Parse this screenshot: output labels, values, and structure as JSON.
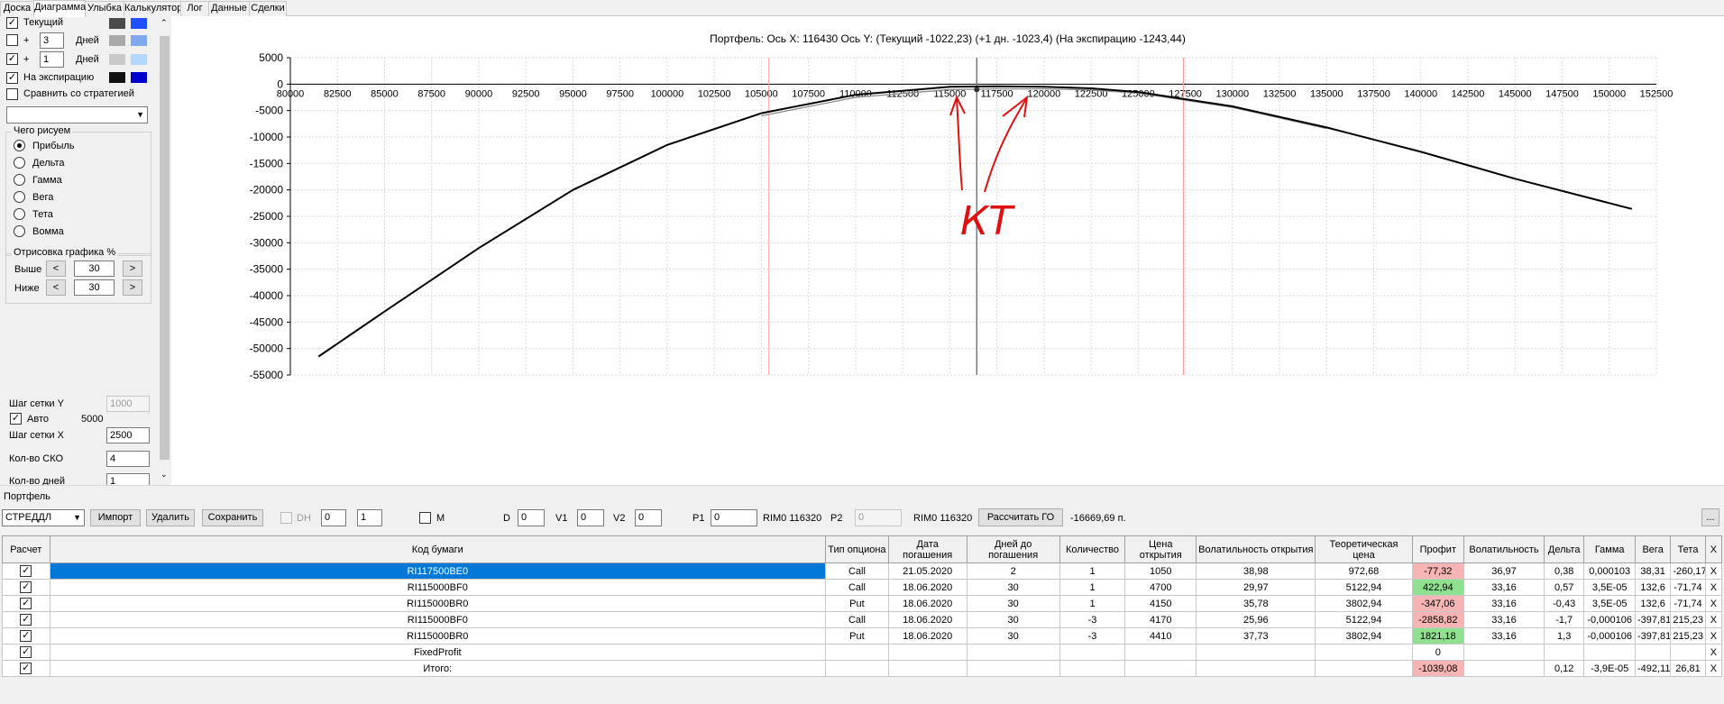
{
  "tabs": [
    "Доска",
    "Диаграмма",
    "Улыбка",
    "Калькулятор",
    "Лог",
    "Данные",
    "Сделки"
  ],
  "left": {
    "row1_label": "Текущий",
    "row2_value": "3",
    "row2_unit": "Дней",
    "row3_value": "1",
    "row3_unit": "Дней",
    "row4_label": "На экспирацию",
    "compare_label": "Сравнить со стратегией",
    "plus": "+",
    "group_draw_title": "Чего рисуем",
    "radios": [
      "Прибыль",
      "Дельта",
      "Гамма",
      "Вега",
      "Тета",
      "Вомма"
    ],
    "group_range_title": "Отрисовка графика %",
    "above_label": "Выше",
    "above_value": "30",
    "below_label": "Ниже",
    "below_value": "30",
    "btn_less": "<",
    "btn_more": ">",
    "grid_y_label": "Шаг сетки Y",
    "grid_y_value": "1000",
    "auto_label": "Авто",
    "auto_value": "5000",
    "grid_x_label": "Шаг сетки X",
    "grid_x_value": "2500",
    "sko_label": "Кол-во СКО",
    "sko_value": "4",
    "days_label": "Кол-во дней",
    "days_value": "1",
    "swatch_colors": [
      "#4a4a4a",
      "#1f4fff",
      "#a8a8a8",
      "#7fa8ee",
      "#c9c9c9",
      "#b3d8fb",
      "#111111",
      "#0000cc"
    ]
  },
  "chart_header": "Портфель: Ось X: 116430 Ось Y:  (Текущий -1022,23)  (+1 дн. -1023,4)  (На экспирацию -1243,44)",
  "annotation_text": "КТ",
  "chart_data": {
    "type": "line",
    "x_ticks": [
      "80000",
      "82500",
      "85000",
      "87500",
      "90000",
      "92500",
      "95000",
      "97500",
      "100000",
      "102500",
      "105000",
      "107500",
      "110000",
      "112500",
      "115000",
      "117500",
      "120000",
      "122500",
      "125000",
      "127500",
      "130000",
      "132500",
      "135000",
      "137500",
      "140000",
      "142500",
      "145000",
      "147500",
      "150000",
      "152500"
    ],
    "y_ticks": [
      "5000",
      "0",
      "-5000",
      "-10000",
      "-15000",
      "-20000",
      "-25000",
      "-30000",
      "-35000",
      "-40000",
      "-45000",
      "-50000",
      "-55000"
    ],
    "xlim": [
      80000,
      152500
    ],
    "ylim": [
      -55000,
      5000
    ],
    "cursor_x": 116430,
    "sd_lines_x": [
      105400,
      127400
    ],
    "series": [
      {
        "color": "#000000",
        "x": [
          81500,
          85000,
          90000,
          95000,
          100000,
          105000,
          110000,
          115000,
          117500,
          120000,
          122500,
          125000,
          130000,
          135000,
          140000,
          145000,
          150000,
          151200
        ],
        "y": [
          -51500,
          -43000,
          -31000,
          -20000,
          -11500,
          -5500,
          -2000,
          -500,
          -400,
          -500,
          -800,
          -1500,
          -4200,
          -8200,
          -12800,
          -17900,
          -22500,
          -23600
        ]
      },
      {
        "color": "#8c8c8c",
        "x": [
          105000,
          110000,
          115000,
          117500,
          120000,
          122500,
          125000,
          130000,
          135000
        ],
        "y": [
          -6000,
          -2500,
          -1022,
          -900,
          -900,
          -1100,
          -1700,
          -4400,
          -8400
        ]
      }
    ]
  },
  "portfolio": {
    "title": "Портфель",
    "strategy": "СТРЕДДЛ",
    "btn_import": "Импорт",
    "btn_delete": "Удалить",
    "btn_save": "Сохранить",
    "dh_label": "DH",
    "dh_val1": "0",
    "dh_val2": "1",
    "m_label": "M",
    "d_label": "D",
    "d_value": "0",
    "v1_label": "V1",
    "v1_value": "0",
    "v2_label": "V2",
    "v2_value": "0",
    "p1_label": "P1",
    "p1_value": "0",
    "rim1": "RIM0 116320",
    "p2_label": "P2",
    "p2_value": "0",
    "rim2": "RIM0 116320",
    "btn_calc": "Рассчитать ГО",
    "go_value": "-16669,69 п.",
    "btn_more": "...",
    "headers": [
      "Расчет",
      "Код бумаги",
      "Тип опциона",
      "Дата погашения",
      "Дней до погашения",
      "Количество",
      "Цена открытия",
      "Волатильность открытия",
      "Теоретическая цена",
      "Профит",
      "Волатильность",
      "Дельта",
      "Гамма",
      "Вега",
      "Тета",
      "X"
    ],
    "rows": [
      [
        "RI117500BE0",
        "Call",
        "21.05.2020",
        "2",
        "1",
        "1050",
        "38,98",
        "972,68",
        "-77,32",
        "36,97",
        "0,38",
        "0,000103",
        "38,31",
        "-260,17",
        "X"
      ],
      [
        "RI115000BF0",
        "Call",
        "18.06.2020",
        "30",
        "1",
        "4700",
        "29,97",
        "5122,94",
        "422,94",
        "33,16",
        "0,57",
        "3,5E-05",
        "132,6",
        "-71,74",
        "X"
      ],
      [
        "RI115000BR0",
        "Put",
        "18.06.2020",
        "30",
        "1",
        "4150",
        "35,78",
        "3802,94",
        "-347,06",
        "33,16",
        "-0,43",
        "3,5E-05",
        "132,6",
        "-71,74",
        "X"
      ],
      [
        "RI115000BF0",
        "Call",
        "18.06.2020",
        "30",
        "-3",
        "4170",
        "25,96",
        "5122,94",
        "-2858,82",
        "33,16",
        "-1,7",
        "-0,000106",
        "-397,81",
        "215,23",
        "X"
      ],
      [
        "RI115000BR0",
        "Put",
        "18.06.2020",
        "30",
        "-3",
        "4410",
        "37,73",
        "3802,94",
        "1821,18",
        "33,16",
        "1,3",
        "-0,000106",
        "-397,81",
        "215,23",
        "X"
      ],
      [
        "FixedProfit",
        "",
        "",
        "",
        "",
        "",
        "",
        "",
        "0",
        "",
        "",
        "",
        "",
        "",
        "X"
      ],
      [
        "Итого:",
        "",
        "",
        "",
        "",
        "",
        "",
        "",
        "-1039,08",
        "",
        "0,12",
        "-3,9E-05",
        "-492,11",
        "26,81",
        "X"
      ]
    ],
    "check": "✓"
  }
}
